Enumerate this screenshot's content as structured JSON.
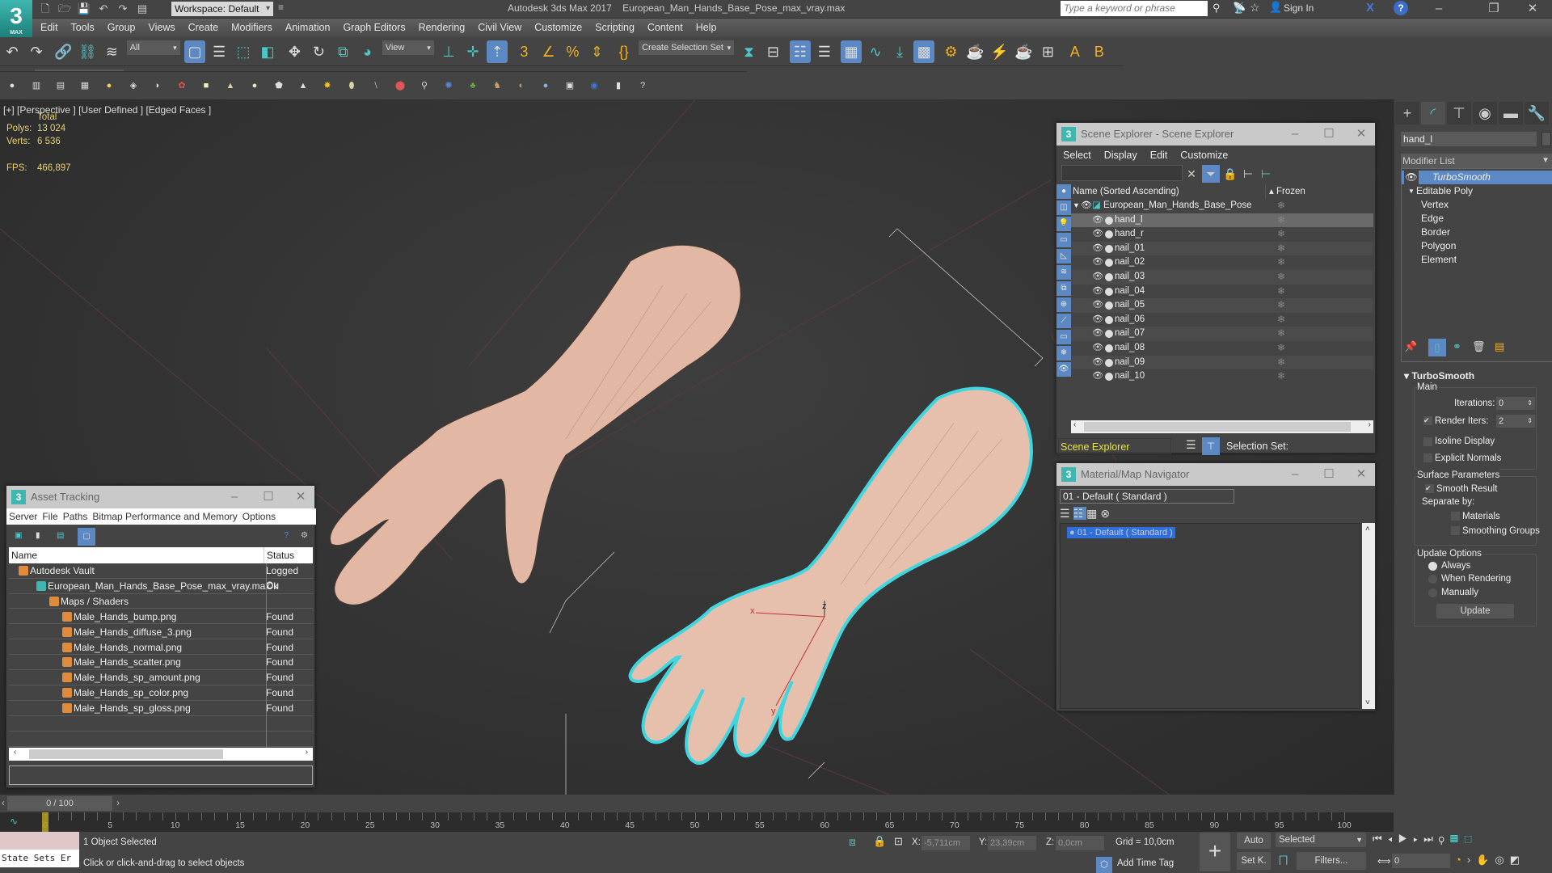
{
  "app": {
    "title": "Autodesk 3ds Max 2017",
    "file": "European_Man_Hands_Base_Pose_max_vray.max",
    "logo": "3",
    "logo_sub": "MAX",
    "workspace": "Workspace: Default",
    "search_placeholder": "Type a keyword or phrase",
    "sign_in": "Sign In"
  },
  "menu": [
    "Edit",
    "Tools",
    "Group",
    "Views",
    "Create",
    "Modifiers",
    "Animation",
    "Graph Editors",
    "Rendering",
    "Civil View",
    "Customize",
    "Scripting",
    "Content",
    "Help"
  ],
  "toolbar": {
    "selection_filter": "All",
    "ref_coord": "View",
    "create_selection_set": "Create Selection Set"
  },
  "viewport": {
    "labels": [
      "[+]",
      "[Perspective ]",
      "[User Defined ]",
      "[Edged Faces ]"
    ],
    "stats": {
      "header": "Total",
      "polys_label": "Polys:",
      "polys": "13 024",
      "verts_label": "Verts:",
      "verts": "6 536",
      "fps_label": "FPS:",
      "fps": "466,897"
    },
    "gizmo_labels": {
      "x": "x",
      "y": "y",
      "z": "z"
    },
    "accent_selection": "#3fd6e0",
    "mesh_color": "#e2b8a4"
  },
  "scene_explorer": {
    "title": "Scene Explorer - Scene Explorer",
    "menu": [
      "Select",
      "Display",
      "Edit",
      "Customize"
    ],
    "col_name": "Name (Sorted Ascending)",
    "col_frozen": "Frozen",
    "root": "European_Man_Hands_Base_Pose",
    "items": [
      "hand_l",
      "hand_r",
      "nail_01",
      "nail_02",
      "nail_03",
      "nail_04",
      "nail_05",
      "nail_06",
      "nail_07",
      "nail_08",
      "nail_09",
      "nail_10"
    ],
    "selected": "hand_l",
    "footer_dropdown": "Scene Explorer",
    "selection_set_label": "Selection Set:"
  },
  "material_navigator": {
    "title": "Material/Map Navigator",
    "field": "01 - Default  ( Standard )",
    "item": "01 - Default  ( Standard )"
  },
  "asset_tracking": {
    "title": "Asset Tracking",
    "menu": [
      "Server",
      "File",
      "Paths",
      "Bitmap Performance and Memory",
      "Options"
    ],
    "col_name": "Name",
    "col_status": "Status",
    "rows": [
      {
        "name": "Autodesk Vault",
        "status": "Logged Ou",
        "indent": 0,
        "icon": "vault"
      },
      {
        "name": "European_Man_Hands_Base_Pose_max_vray.max",
        "status": "Ok",
        "indent": 1,
        "icon": "max"
      },
      {
        "name": "Maps / Shaders",
        "status": "",
        "indent": 2,
        "icon": "folder"
      },
      {
        "name": "Male_Hands_bump.png",
        "status": "Found",
        "indent": 3,
        "icon": "png"
      },
      {
        "name": "Male_Hands_diffuse_3.png",
        "status": "Found",
        "indent": 3,
        "icon": "png"
      },
      {
        "name": "Male_Hands_normal.png",
        "status": "Found",
        "indent": 3,
        "icon": "png"
      },
      {
        "name": "Male_Hands_scatter.png",
        "status": "Found",
        "indent": 3,
        "icon": "png"
      },
      {
        "name": "Male_Hands_sp_amount.png",
        "status": "Found",
        "indent": 3,
        "icon": "png"
      },
      {
        "name": "Male_Hands_sp_color.png",
        "status": "Found",
        "indent": 3,
        "icon": "png"
      },
      {
        "name": "Male_Hands_sp_gloss.png",
        "status": "Found",
        "indent": 3,
        "icon": "png"
      }
    ]
  },
  "command_panel": {
    "object_name": "hand_l",
    "modifier_list": "Modifier List",
    "stack": [
      {
        "label": "TurboSmooth",
        "level": 0,
        "selected": true
      },
      {
        "label": "Editable Poly",
        "level": 0,
        "selected": false
      },
      {
        "label": "Vertex",
        "level": 1
      },
      {
        "label": "Edge",
        "level": 1
      },
      {
        "label": "Border",
        "level": 1
      },
      {
        "label": "Polygon",
        "level": 1
      },
      {
        "label": "Element",
        "level": 1
      }
    ],
    "turbosmooth": {
      "title": "TurboSmooth",
      "main": "Main",
      "iterations_label": "Iterations:",
      "iterations": "0",
      "render_iters_label": "Render Iters:",
      "render_iters": "2",
      "render_iters_checked": true,
      "isoline": "Isoline Display",
      "explicit_normals": "Explicit Normals",
      "surface_params": "Surface Parameters",
      "smooth_result": "Smooth Result",
      "separate_by": "Separate by:",
      "materials": "Materials",
      "smoothing_groups": "Smoothing Groups",
      "update_options": "Update Options",
      "always": "Always",
      "when_rendering": "When Rendering",
      "manually": "Manually",
      "update": "Update",
      "update_mode": "Always"
    }
  },
  "timeline": {
    "frame": "0 / 100",
    "current": 0,
    "end": 100,
    "ticks": [
      0,
      5,
      10,
      15,
      20,
      25,
      30,
      35,
      40,
      45,
      50,
      55,
      60,
      65,
      70,
      75,
      80,
      85,
      90,
      95,
      100
    ]
  },
  "status": {
    "maxscript": "State Sets Er",
    "selected": "1 Object Selected",
    "prompt": "Click or click-and-drag to select objects",
    "x_label": "X:",
    "x": "-5,711cm",
    "y_label": "Y:",
    "y": "23,39cm",
    "z_label": "Z:",
    "z": "0,0cm",
    "grid": "Grid = 10,0cm",
    "add_time_tag": "Add Time Tag",
    "auto": "Auto",
    "set_key": "Set K.",
    "key_filter": "Selected",
    "filters": "Filters...",
    "frame_field": "0"
  }
}
